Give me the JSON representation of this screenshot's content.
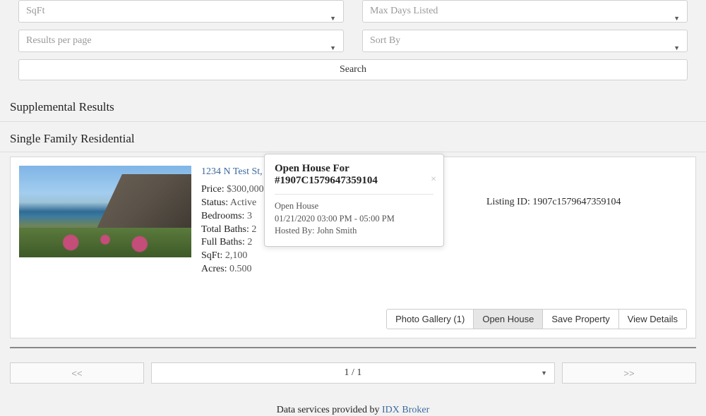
{
  "filters": {
    "sqft": "SqFt",
    "max_days": "Max Days Listed",
    "results_per_page": "Results per page",
    "sort_by": "Sort By",
    "search_label": "Search"
  },
  "sections": {
    "supplemental": "Supplemental Results",
    "category": "Single Family Residential"
  },
  "listing": {
    "title": "1234 N Test St, Eu…",
    "details": [
      {
        "label": "Price:",
        "value": "$300,000"
      },
      {
        "label": "Status:",
        "value": "Active"
      },
      {
        "label": "Bedrooms:",
        "value": "3"
      },
      {
        "label": "Total Baths:",
        "value": "2"
      },
      {
        "label": "Full Baths:",
        "value": "2"
      },
      {
        "label": "SqFt:",
        "value": "2,100"
      },
      {
        "label": "Acres:",
        "value": "0.500"
      }
    ],
    "listing_id_label": "Listing ID:",
    "listing_id": "1907c1579647359104"
  },
  "popover": {
    "title": "Open House For #1907C1579647359104",
    "line1": "Open House",
    "line2": "01/21/2020 03:00 PM - 05:00 PM",
    "line3": "Hosted By: John Smith"
  },
  "actions": {
    "gallery": "Photo Gallery (1)",
    "open_house": "Open House",
    "save": "Save Property",
    "view": "View Details"
  },
  "pager": {
    "prev": "<<",
    "current": "1 / 1",
    "next": ">>"
  },
  "footer": {
    "text": "Data services provided by ",
    "link": "IDX Broker"
  }
}
